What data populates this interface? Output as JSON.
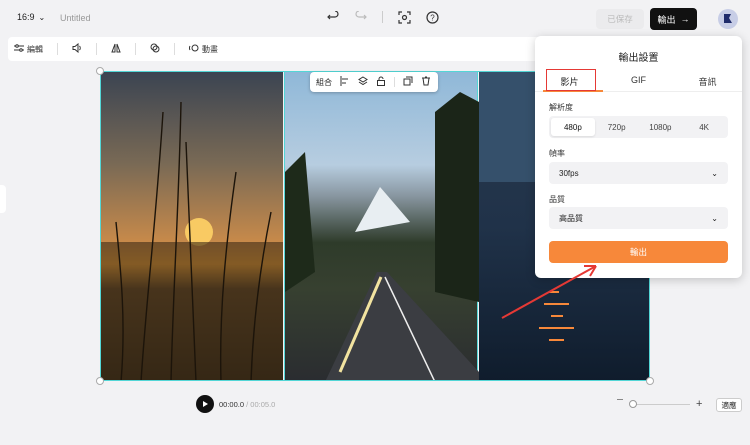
{
  "topbar": {
    "ratio": "16:9",
    "doc_title": "Untitled",
    "save_label": "已保存",
    "export_label": "輸出"
  },
  "toolbar": {
    "edit_label": "編輯",
    "animate_label": "動畫"
  },
  "float_bar": {
    "group_label": "組合"
  },
  "export_panel": {
    "title": "輸出設置",
    "tabs": [
      "影片",
      "GIF",
      "音訊"
    ],
    "resolution_label": "解析度",
    "resolutions": [
      "480p",
      "720p",
      "1080p",
      "4K"
    ],
    "selected_resolution": "480p",
    "framerate_label": "幀率",
    "framerate_value": "30fps",
    "quality_label": "品質",
    "quality_value": "高品質",
    "export_button": "輸出"
  },
  "playback": {
    "current_time": "00:00.0",
    "separator": " / ",
    "total_time": "00:05.0",
    "fit_label": "適應"
  },
  "colors": {
    "accent": "#f7883a",
    "selection": "#53d6d6",
    "annotation": "#e53935"
  }
}
